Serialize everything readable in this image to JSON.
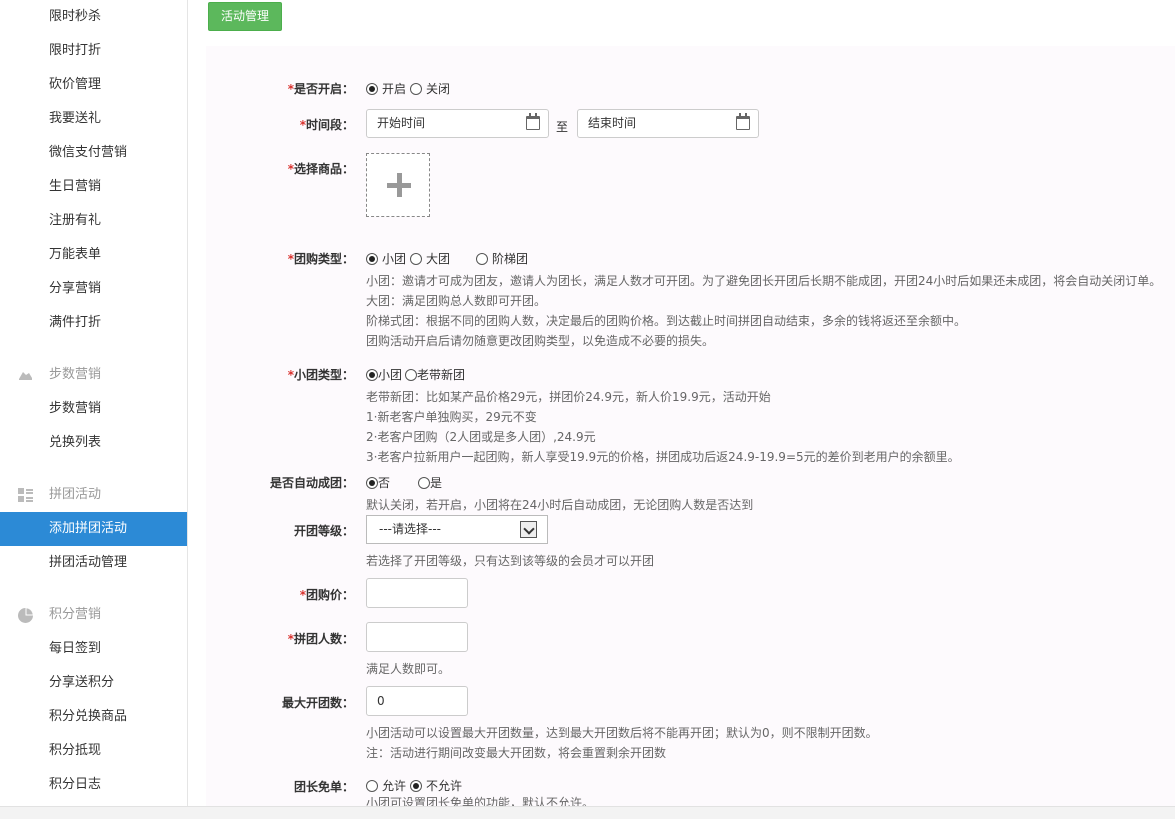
{
  "sidebar": {
    "items": [
      {
        "label": "限时秒杀"
      },
      {
        "label": "限时打折"
      },
      {
        "label": "砍价管理"
      },
      {
        "label": "我要送礼"
      },
      {
        "label": "微信支付营销"
      },
      {
        "label": "生日营销"
      },
      {
        "label": "注册有礼"
      },
      {
        "label": "万能表单"
      },
      {
        "label": "分享营销"
      },
      {
        "label": "满件打折"
      }
    ],
    "group_step": {
      "label": "步数营销",
      "icon": "shoe-icon"
    },
    "step_items": [
      {
        "label": "步数营销"
      },
      {
        "label": "兑换列表"
      }
    ],
    "group_pin": {
      "label": "拼团活动",
      "icon": "grid-icon"
    },
    "pin_items": [
      {
        "label": "添加拼团活动"
      },
      {
        "label": "拼团活动管理"
      }
    ],
    "group_points": {
      "label": "积分营销",
      "icon": "pie-chart-icon"
    },
    "points_items": [
      {
        "label": "每日签到"
      },
      {
        "label": "分享送积分"
      },
      {
        "label": "积分兑换商品"
      },
      {
        "label": "积分抵现"
      },
      {
        "label": "积分日志"
      }
    ],
    "active": "添加拼团活动",
    "active_color": "#2c8ad6"
  },
  "toolbar": {
    "manage_button": "活动管理",
    "button_color": "#5cb85c"
  },
  "form": {
    "enabled": {
      "label": "是否开启：",
      "on": "开启",
      "off": "关闭",
      "selected": "开启"
    },
    "period": {
      "label": "时间段：",
      "start_placeholder": "开始时间",
      "separator": "至",
      "end_placeholder": "结束时间"
    },
    "product": {
      "label": "选择商品："
    },
    "group_type": {
      "label": "团购类型：",
      "options": [
        "小团",
        "大团",
        "阶梯团"
      ],
      "selected": "小团",
      "help": [
        "小团：邀请才可成为团友，邀请人为团长，满足人数才可开团。为了避免团长开团后长期不能成团，开团24小时后如果还未成团，将会自动关闭订单。",
        "大团：满足团购总人数即可开团。",
        "阶梯式团：根据不同的团购人数，决定最后的团购价格。到达截止时间拼团自动结束，多余的钱将返还至余额中。",
        "团购活动开启后请勿随意更改团购类型，以免造成不必要的损失。"
      ]
    },
    "small_type": {
      "label": "小团类型：",
      "options": [
        "小团",
        "老带新团"
      ],
      "selected": "小团",
      "help": [
        "老带新团：比如某产品价格29元，拼团价24.9元，新人价19.9元，活动开始",
        "1·新老客户单独购买，29元不变",
        "2·老客户团购（2人团或是多人团）,24.9元",
        "3·老客户拉新用户一起团购，新人享受19.9元的价格，拼团成功后返24.9-19.9=5元的差价到老用户的余额里。"
      ]
    },
    "auto_group": {
      "label": "是否自动成团：",
      "options": [
        "否",
        "是"
      ],
      "selected": "否",
      "help": "默认关闭，若开启，小团将在24小时后自动成团，无论团购人数是否达到"
    },
    "level": {
      "label": "开团等级：",
      "value": "---请选择---",
      "help": "若选择了开团等级，只有达到该等级的会员才可以开团"
    },
    "price": {
      "label": "团购价：",
      "value": ""
    },
    "members": {
      "label": "拼团人数：",
      "value": "",
      "help": "满足人数即可。"
    },
    "max_groups": {
      "label": "最大开团数：",
      "value": "0",
      "help": [
        "小团活动可以设置最大开团数量，达到最大开团数后将不能再开团；默认为0，则不限制开团数。",
        "注：活动进行期间改变最大开团数，将会重置剩余开团数"
      ]
    },
    "leader_free": {
      "label": "团长免单：",
      "options": [
        "允许",
        "不允许"
      ],
      "selected": "不允许",
      "help": "小团可设置团长免单的功能，默认不允许。"
    },
    "required_mark": "*"
  }
}
